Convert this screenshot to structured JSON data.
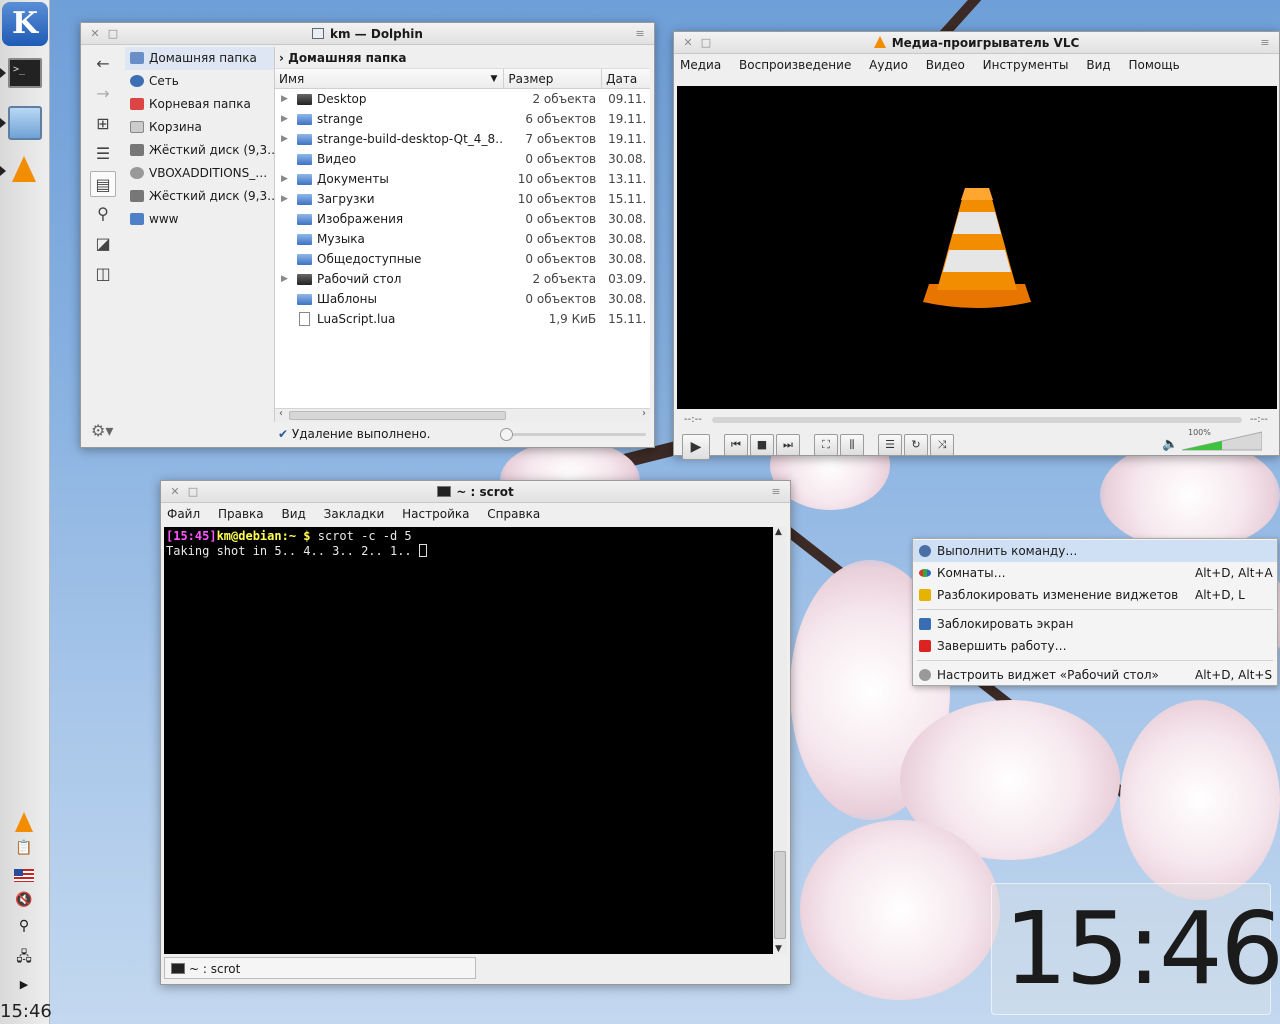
{
  "panel": {
    "kmenu_label": "K",
    "clock": "15:46",
    "term_icon_text": ">_"
  },
  "dolphin": {
    "title": "km — Dolphin",
    "places": [
      {
        "label": "Домашняя папка",
        "icon": "home-icon",
        "color": "#6a8fc6"
      },
      {
        "label": "Сеть",
        "icon": "network-icon",
        "color": "#3d6fb4"
      },
      {
        "label": "Корневая папка",
        "icon": "root-folder-icon",
        "color": "#d44"
      },
      {
        "label": "Корзина",
        "icon": "trash-icon",
        "color": "#bbb"
      },
      {
        "label": "Жёсткий диск (9,3…",
        "icon": "harddisk-icon",
        "color": "#777"
      },
      {
        "label": "VBOXADDITIONS_…",
        "icon": "cdrom-icon",
        "color": "#999"
      },
      {
        "label": "Жёсткий диск (9,3…",
        "icon": "harddisk-icon",
        "color": "#777"
      },
      {
        "label": "www",
        "icon": "folder-icon",
        "color": "#4f7fc6"
      }
    ],
    "breadcrumb": "Домашняя папка",
    "columns": {
      "name": "Имя",
      "size": "Размер",
      "date": "Дата"
    },
    "files": [
      {
        "name": "Desktop",
        "size": "2 объекта",
        "date": "09.11.",
        "type": "desktop",
        "expandable": true
      },
      {
        "name": "strange",
        "size": "6 объектов",
        "date": "19.11.",
        "type": "folder",
        "expandable": true
      },
      {
        "name": "strange-build-desktop-Qt_4_8…",
        "size": "7 объектов",
        "date": "19.11.",
        "type": "folder",
        "expandable": true
      },
      {
        "name": "Видео",
        "size": "0 объектов",
        "date": "30.08.",
        "type": "folder",
        "expandable": false
      },
      {
        "name": "Документы",
        "size": "10 объектов",
        "date": "13.11.",
        "type": "folder",
        "expandable": true
      },
      {
        "name": "Загрузки",
        "size": "10 объектов",
        "date": "15.11.",
        "type": "folder",
        "expandable": true
      },
      {
        "name": "Изображения",
        "size": "0 объектов",
        "date": "30.08.",
        "type": "folder",
        "expandable": false
      },
      {
        "name": "Музыка",
        "size": "0 объектов",
        "date": "30.08.",
        "type": "folder",
        "expandable": false
      },
      {
        "name": "Общедоступные",
        "size": "0 объектов",
        "date": "30.08.",
        "type": "folder",
        "expandable": false
      },
      {
        "name": "Рабочий стол",
        "size": "2 объекта",
        "date": "03.09.",
        "type": "desktop",
        "expandable": true
      },
      {
        "name": "Шаблоны",
        "size": "0 объектов",
        "date": "30.08.",
        "type": "folder",
        "expandable": false
      },
      {
        "name": "LuaScript.lua",
        "size": "1,9 КиБ",
        "date": "15.11.",
        "type": "file",
        "expandable": false
      }
    ],
    "status": "Удаление выполнено."
  },
  "vlc": {
    "title": "Медиа-проигрыватель VLC",
    "menu": [
      "Медиа",
      "Воспроизведение",
      "Аудио",
      "Видео",
      "Инструменты",
      "Вид",
      "Помощь"
    ],
    "time_elapsed": "--:--",
    "time_total": "--:--",
    "volume": "100%",
    "volume_level": 1.0
  },
  "terminal": {
    "title": "~ : scrot",
    "menu": [
      "Файл",
      "Правка",
      "Вид",
      "Закладки",
      "Настройка",
      "Справка"
    ],
    "prompt_time": "[15:45]",
    "prompt_user": "km@debian",
    "prompt_path": ":~ $",
    "command": " scrot -c -d 5",
    "output": "Taking shot in 5.. 4.. 3.. 2.. 1.. ",
    "tab_label": "~ : scrot"
  },
  "context_menu": {
    "items": [
      {
        "label": "Выполнить команду…",
        "shortcut": "",
        "icon": "run-command-icon",
        "color": "#4a6fa5"
      },
      {
        "label": "Комнаты…",
        "shortcut": "Alt+D, Alt+A",
        "icon": "activities-icon",
        "color": "#3a3"
      },
      {
        "label": "Разблокировать изменение виджетов",
        "shortcut": "Alt+D, L",
        "icon": "unlock-icon",
        "color": "#e4b400"
      },
      {
        "label": "Заблокировать экран",
        "shortcut": "",
        "icon": "lock-screen-icon",
        "color": "#3a6db0"
      },
      {
        "label": "Завершить работу…",
        "shortcut": "",
        "icon": "shutdown-icon",
        "color": "#d22"
      },
      {
        "label": "Настроить виджет «Рабочий стол»",
        "shortcut": "Alt+D, Alt+S",
        "icon": "configure-icon",
        "color": "#888"
      }
    ]
  },
  "clock_widget": {
    "time": "15:46"
  }
}
